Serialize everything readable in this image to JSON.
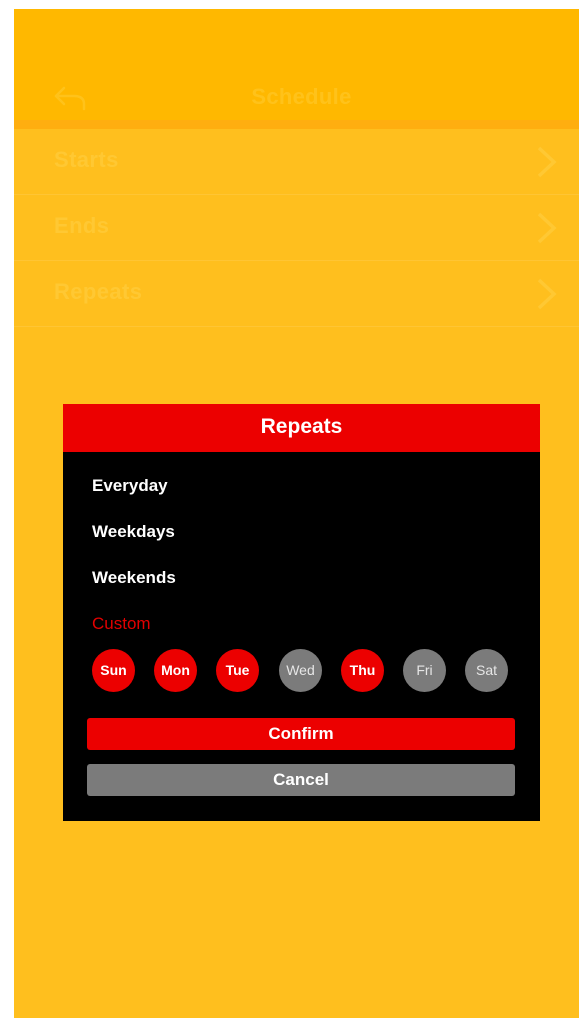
{
  "header": {
    "title": "Schedule"
  },
  "rows": [
    {
      "label": "Starts"
    },
    {
      "label": "Ends"
    },
    {
      "label": "Repeats"
    }
  ],
  "dialog": {
    "title": "Repeats",
    "options": [
      "Everyday",
      "Weekdays",
      "Weekends"
    ],
    "custom_label": "Custom",
    "days": [
      {
        "label": "Sun",
        "selected": true
      },
      {
        "label": "Mon",
        "selected": true
      },
      {
        "label": "Tue",
        "selected": true
      },
      {
        "label": "Wed",
        "selected": false
      },
      {
        "label": "Thu",
        "selected": true
      },
      {
        "label": "Fri",
        "selected": false
      },
      {
        "label": "Sat",
        "selected": false
      }
    ],
    "confirm_label": "Confirm",
    "cancel_label": "Cancel"
  },
  "colors": {
    "background": "#ffbf1e",
    "header": "#ffb800",
    "accent_red": "#ec0000",
    "inactive_gray": "#7b7b7b",
    "dialog_bg": "#000000"
  }
}
